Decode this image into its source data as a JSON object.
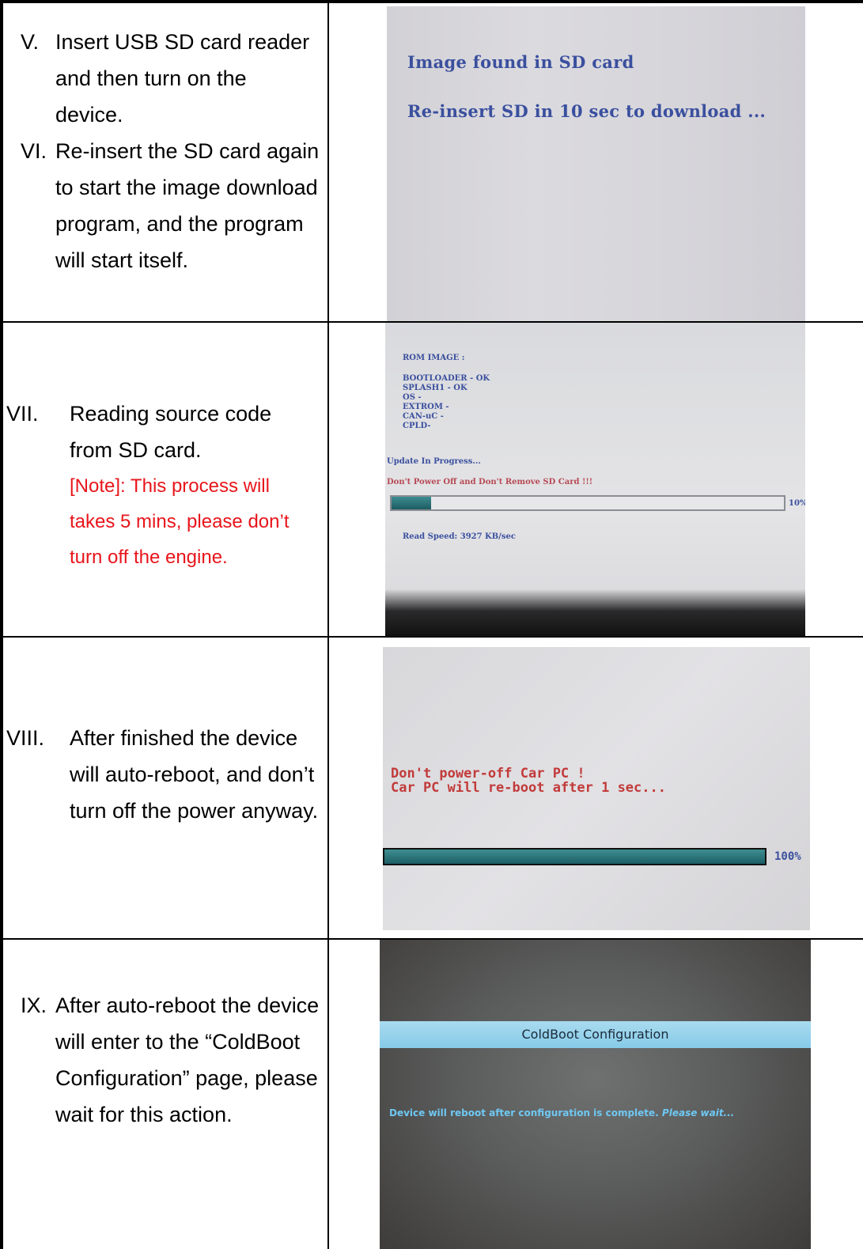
{
  "rows": [
    {
      "steps": [
        {
          "num": "V.",
          "text": "Insert USB SD card reader and then turn on the device."
        },
        {
          "num": "VI.",
          "text": "Re-insert the SD card again to start the image download program, and the program will start itself."
        }
      ],
      "screen": {
        "line1": "Image found in SD card",
        "line2": "Re-insert SD in 10 sec to download ..."
      }
    },
    {
      "steps": [
        {
          "num": "VII.",
          "text": "Reading source code from SD card.",
          "note": "[Note]: This process will takes 5 mins, please don’t turn off the engine."
        }
      ],
      "screen": {
        "header": "ROM IMAGE :",
        "items": [
          "BOOTLOADER - OK",
          "SPLASH1 - OK",
          "OS -",
          "EXTROM -",
          "CAN-uC -",
          "CPLD-"
        ],
        "progress_title": "Update In Progress...",
        "warning": "Don't Power Off and Don't Remove SD Card !!!",
        "progress_fraction": 0.1,
        "progress_label": "10%",
        "speed": "Read Speed: 3927 KB/sec"
      }
    },
    {
      "steps": [
        {
          "num": "VIII.",
          "text": "After finished the device will auto-reboot, and don’t turn off the power anyway."
        }
      ],
      "screen": {
        "line1": "Don't power-off Car PC !",
        "line2": "Car PC will re-boot after 1 sec...",
        "progress_fraction": 1.0,
        "progress_label": "100%"
      }
    },
    {
      "steps": [
        {
          "num": "IX.",
          "text": "After auto-reboot the device will enter to the “ColdBoot Configuration” page, please wait for this action."
        }
      ],
      "screen": {
        "banner": "ColdBoot Configuration",
        "message": "Device will reboot after configuration is complete.",
        "message_italic": "Please wait..."
      }
    }
  ],
  "colors": {
    "note": "#e8151b",
    "screen_text_blue": "#3a4f9e",
    "screen_text_red": "#c23a3a",
    "banner": "#9fd6ee"
  }
}
